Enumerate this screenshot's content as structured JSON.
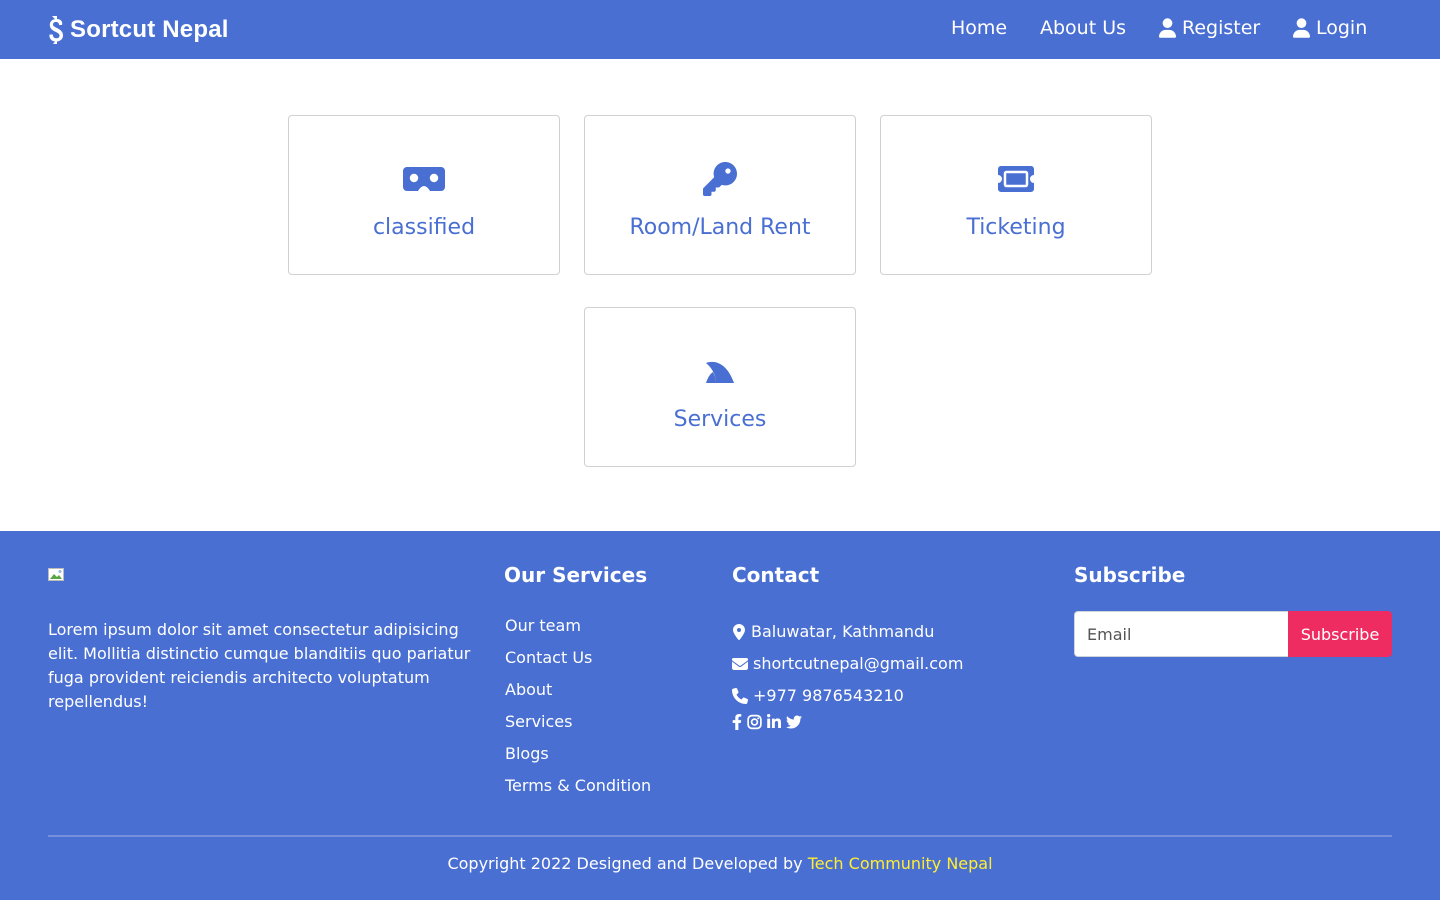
{
  "navbar": {
    "brand": "Sortcut Nepal",
    "links": [
      {
        "label": "Home"
      },
      {
        "label": "About Us"
      },
      {
        "label": "Register",
        "icon": "user-icon"
      },
      {
        "label": "Login",
        "icon": "user-icon"
      }
    ],
    "bg_color": "#4a6fd2"
  },
  "cards": [
    {
      "label": "classified",
      "icon": "vr-cardboard-icon"
    },
    {
      "label": "Room/Land Rent",
      "icon": "key-icon"
    },
    {
      "label": "Ticketing",
      "icon": "ticket-icon"
    },
    {
      "label": "Services",
      "icon": "fin-icon"
    }
  ],
  "footer": {
    "description": "Lorem ipsum dolor sit amet consectetur adipisicing elit. Mollitia distinctio cumque blanditiis quo pariatur fuga provident reiciendis architecto voluptatum repellendus!",
    "services": {
      "heading": "Our Services",
      "items": [
        "Our team",
        "Contact Us",
        "About",
        "Services",
        "Blogs",
        "Terms & Condition"
      ]
    },
    "contact": {
      "heading": "Contact",
      "address": "Baluwatar, Kathmandu",
      "email": "shortcutnepal@gmail.com",
      "phone": "+977 9876543210",
      "social": [
        "facebook-icon",
        "instagram-icon",
        "linkedin-icon",
        "twitter-icon"
      ]
    },
    "subscribe": {
      "heading": "Subscribe",
      "placeholder": "Email",
      "button": "Subscribe",
      "button_color": "#ee2c62"
    },
    "copyright_prefix": "Copyright 2022 Designed and Developed by",
    "copyright_link": "Tech Community Nepal",
    "link_color": "#ffee33"
  }
}
